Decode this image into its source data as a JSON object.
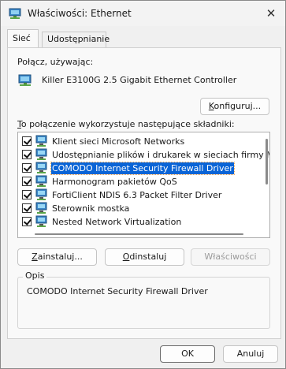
{
  "window": {
    "title": "Właściwości: Ethernet",
    "close_glyph": "✕"
  },
  "tabs": [
    {
      "label": "Sieć",
      "active": true
    },
    {
      "label": "Udostępnianie",
      "active": false
    }
  ],
  "connect_using": {
    "label": "Połącz, używając:",
    "adapter_name": "Killer E3100G 2.5 Gigabit Ethernet Controller",
    "adapter_icon": "network-adapter-icon"
  },
  "configure_button": {
    "label_rest": "onfiguruj...",
    "label_underline": "K"
  },
  "components": {
    "label_underline": "T",
    "label_rest": "o połączenie wykorzystuje następujące składniki:",
    "items": [
      {
        "label": "Klient sieci Microsoft Networks",
        "checked": true,
        "icon": "network-client-icon"
      },
      {
        "label": "Udostępnianie plików i drukarek w sieciach firmy Micros",
        "checked": true,
        "icon": "file-sharing-icon"
      },
      {
        "label": "COMODO Internet Security Firewall Driver",
        "checked": true,
        "selected": true,
        "icon": "network-service-icon"
      },
      {
        "label": "Harmonogram pakietów QoS",
        "checked": true,
        "icon": "network-service-icon"
      },
      {
        "label": "FortiClient NDIS 6.3 Packet Filter Driver",
        "checked": true,
        "icon": "network-service-icon"
      },
      {
        "label": "Sterownik mostka",
        "checked": true,
        "icon": "network-service-icon"
      },
      {
        "label": "Nested Network Virtualization",
        "checked": true,
        "icon": "network-service-icon"
      }
    ]
  },
  "action_buttons": {
    "install": {
      "label_underline": "Z",
      "label_rest": "ainstaluj...",
      "enabled": true
    },
    "uninstall": {
      "label_underline": "O",
      "label_rest": "dinstaluj",
      "enabled": true
    },
    "properties": {
      "label": "Właściwości",
      "enabled": false
    }
  },
  "description": {
    "title": "Opis",
    "text": "COMODO Internet Security Firewall Driver"
  },
  "footer": {
    "ok_label": "OK",
    "cancel_label": "Anuluj"
  },
  "colors": {
    "selection": "#0a64d6",
    "window_bg": "#f0f0f0",
    "panel_bg": "#f9f9f9"
  }
}
